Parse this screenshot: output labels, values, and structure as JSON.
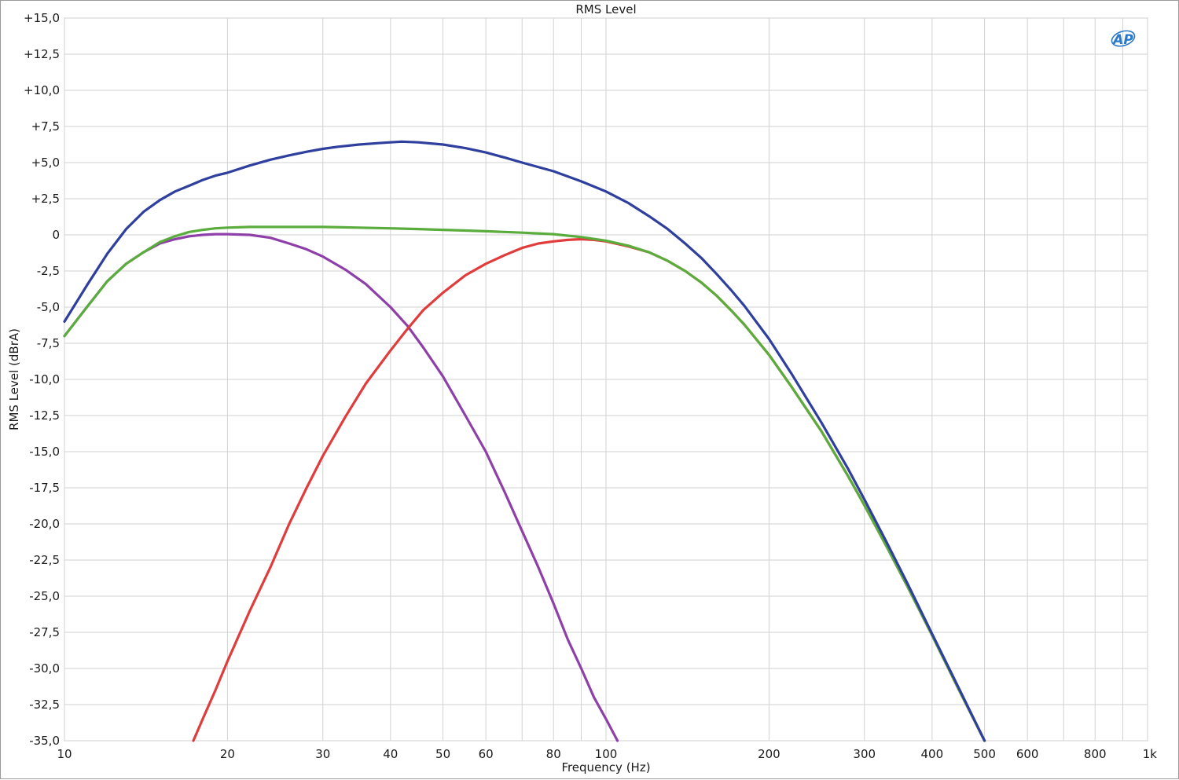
{
  "chart_data": {
    "type": "line",
    "title": "RMS Level",
    "xlabel": "Frequency (Hz)",
    "ylabel": "RMS Level (dBrA)",
    "xscale": "log",
    "xlim": [
      10,
      1000
    ],
    "ylim": [
      -35,
      15
    ],
    "grid": true,
    "legend": "none",
    "logo": "AP",
    "x_ticks": [
      {
        "value": 10,
        "label": "10"
      },
      {
        "value": 20,
        "label": "20"
      },
      {
        "value": 30,
        "label": "30"
      },
      {
        "value": 40,
        "label": "40"
      },
      {
        "value": 50,
        "label": "50"
      },
      {
        "value": 60,
        "label": "60"
      },
      {
        "value": 80,
        "label": "80"
      },
      {
        "value": 100,
        "label": "100"
      },
      {
        "value": 200,
        "label": "200"
      },
      {
        "value": 300,
        "label": "300"
      },
      {
        "value": 400,
        "label": "400"
      },
      {
        "value": 500,
        "label": "500"
      },
      {
        "value": 600,
        "label": "600"
      },
      {
        "value": 800,
        "label": "800"
      },
      {
        "value": 1000,
        "label": "1k"
      }
    ],
    "x_minor_grid": [
      70,
      90,
      700,
      900
    ],
    "y_ticks": [
      {
        "value": 15,
        "label": "+15,0"
      },
      {
        "value": 12.5,
        "label": "+12,5"
      },
      {
        "value": 10,
        "label": "+10,0"
      },
      {
        "value": 7.5,
        "label": "+7,5"
      },
      {
        "value": 5,
        "label": "+5,0"
      },
      {
        "value": 2.5,
        "label": "+2,5"
      },
      {
        "value": 0,
        "label": "0"
      },
      {
        "value": -2.5,
        "label": "-2,5"
      },
      {
        "value": -5,
        "label": "-5,0"
      },
      {
        "value": -7.5,
        "label": "-7,5"
      },
      {
        "value": -10,
        "label": "-10,0"
      },
      {
        "value": -12.5,
        "label": "-12,5"
      },
      {
        "value": -15,
        "label": "-15,0"
      },
      {
        "value": -17.5,
        "label": "-17,5"
      },
      {
        "value": -20,
        "label": "-20,0"
      },
      {
        "value": -22.5,
        "label": "-22,5"
      },
      {
        "value": -25,
        "label": "-25,0"
      },
      {
        "value": -27.5,
        "label": "-27,5"
      },
      {
        "value": -30,
        "label": "-30,0"
      },
      {
        "value": -32.5,
        "label": "-32,5"
      },
      {
        "value": -35,
        "label": "-35,0"
      }
    ],
    "series": [
      {
        "color": "#8e3fa8",
        "points": [
          [
            10,
            -7
          ],
          [
            11,
            -5
          ],
          [
            12,
            -3.2
          ],
          [
            13,
            -2
          ],
          [
            14,
            -1.2
          ],
          [
            15,
            -0.6
          ],
          [
            16,
            -0.3
          ],
          [
            17,
            -0.1
          ],
          [
            18,
            0
          ],
          [
            19,
            0.05
          ],
          [
            20,
            0.05
          ],
          [
            22,
            0
          ],
          [
            24,
            -0.2
          ],
          [
            26,
            -0.6
          ],
          [
            28,
            -1
          ],
          [
            30,
            -1.5
          ],
          [
            33,
            -2.4
          ],
          [
            36,
            -3.4
          ],
          [
            40,
            -5
          ],
          [
            43,
            -6.3
          ],
          [
            46,
            -7.8
          ],
          [
            50,
            -9.8
          ],
          [
            55,
            -12.5
          ],
          [
            60,
            -15
          ],
          [
            65,
            -17.8
          ],
          [
            70,
            -20.5
          ],
          [
            75,
            -23
          ],
          [
            80,
            -25.5
          ],
          [
            85,
            -28
          ],
          [
            90,
            -30
          ],
          [
            95,
            -32
          ],
          [
            100,
            -33.5
          ],
          [
            105,
            -35
          ]
        ]
      },
      {
        "color": "#e03c3c",
        "points": [
          [
            17.3,
            -35
          ],
          [
            18,
            -33.5
          ],
          [
            19,
            -31.5
          ],
          [
            20,
            -29.5
          ],
          [
            22,
            -26
          ],
          [
            24,
            -23
          ],
          [
            26,
            -20
          ],
          [
            28,
            -17.5
          ],
          [
            30,
            -15.3
          ],
          [
            33,
            -12.6
          ],
          [
            36,
            -10.3
          ],
          [
            40,
            -8
          ],
          [
            43,
            -6.5
          ],
          [
            46,
            -5.2
          ],
          [
            50,
            -4
          ],
          [
            55,
            -2.8
          ],
          [
            60,
            -2
          ],
          [
            65,
            -1.4
          ],
          [
            70,
            -0.9
          ],
          [
            75,
            -0.6
          ],
          [
            80,
            -0.45
          ],
          [
            85,
            -0.35
          ],
          [
            90,
            -0.3
          ],
          [
            95,
            -0.35
          ],
          [
            100,
            -0.45
          ],
          [
            110,
            -0.8
          ],
          [
            120,
            -1.2
          ],
          [
            130,
            -1.8
          ],
          [
            140,
            -2.5
          ],
          [
            150,
            -3.3
          ],
          [
            160,
            -4.2
          ],
          [
            170,
            -5.2
          ],
          [
            180,
            -6.2
          ],
          [
            200,
            -8.3
          ],
          [
            220,
            -10.5
          ],
          [
            250,
            -13.6
          ],
          [
            280,
            -16.7
          ],
          [
            300,
            -18.7
          ],
          [
            330,
            -21.6
          ],
          [
            360,
            -24.3
          ],
          [
            400,
            -27.7
          ],
          [
            450,
            -31.6
          ],
          [
            500,
            -35
          ]
        ]
      },
      {
        "color": "#5aad3c",
        "points": [
          [
            10,
            -7
          ],
          [
            11,
            -5
          ],
          [
            12,
            -3.2
          ],
          [
            13,
            -2
          ],
          [
            14,
            -1.2
          ],
          [
            15,
            -0.5
          ],
          [
            16,
            -0.1
          ],
          [
            17,
            0.2
          ],
          [
            18,
            0.35
          ],
          [
            19,
            0.45
          ],
          [
            20,
            0.5
          ],
          [
            22,
            0.55
          ],
          [
            25,
            0.55
          ],
          [
            30,
            0.55
          ],
          [
            35,
            0.5
          ],
          [
            40,
            0.45
          ],
          [
            45,
            0.4
          ],
          [
            50,
            0.35
          ],
          [
            55,
            0.3
          ],
          [
            60,
            0.25
          ],
          [
            70,
            0.15
          ],
          [
            80,
            0.05
          ],
          [
            90,
            -0.15
          ],
          [
            100,
            -0.4
          ],
          [
            110,
            -0.75
          ],
          [
            120,
            -1.2
          ],
          [
            130,
            -1.8
          ],
          [
            140,
            -2.5
          ],
          [
            150,
            -3.3
          ],
          [
            160,
            -4.2
          ],
          [
            170,
            -5.2
          ],
          [
            180,
            -6.2
          ],
          [
            200,
            -8.3
          ],
          [
            220,
            -10.5
          ],
          [
            250,
            -13.6
          ],
          [
            280,
            -16.7
          ],
          [
            300,
            -18.7
          ],
          [
            330,
            -21.6
          ],
          [
            360,
            -24.3
          ],
          [
            400,
            -27.7
          ],
          [
            450,
            -31.6
          ],
          [
            500,
            -35
          ]
        ]
      },
      {
        "color": "#2e3f9e",
        "points": [
          [
            10,
            -6
          ],
          [
            11,
            -3.5
          ],
          [
            12,
            -1.3
          ],
          [
            13,
            0.4
          ],
          [
            14,
            1.6
          ],
          [
            15,
            2.4
          ],
          [
            16,
            3
          ],
          [
            17,
            3.4
          ],
          [
            18,
            3.8
          ],
          [
            19,
            4.1
          ],
          [
            20,
            4.3
          ],
          [
            22,
            4.8
          ],
          [
            24,
            5.2
          ],
          [
            26,
            5.5
          ],
          [
            28,
            5.75
          ],
          [
            30,
            5.95
          ],
          [
            32,
            6.1
          ],
          [
            35,
            6.25
          ],
          [
            38,
            6.35
          ],
          [
            40,
            6.4
          ],
          [
            42,
            6.45
          ],
          [
            45,
            6.4
          ],
          [
            50,
            6.25
          ],
          [
            55,
            6.0
          ],
          [
            60,
            5.7
          ],
          [
            65,
            5.35
          ],
          [
            70,
            5.0
          ],
          [
            80,
            4.4
          ],
          [
            90,
            3.7
          ],
          [
            100,
            3.0
          ],
          [
            110,
            2.2
          ],
          [
            120,
            1.3
          ],
          [
            130,
            0.4
          ],
          [
            140,
            -0.6
          ],
          [
            150,
            -1.6
          ],
          [
            160,
            -2.7
          ],
          [
            170,
            -3.8
          ],
          [
            180,
            -4.9
          ],
          [
            200,
            -7.2
          ],
          [
            220,
            -9.6
          ],
          [
            250,
            -13.0
          ],
          [
            280,
            -16.2
          ],
          [
            300,
            -18.3
          ],
          [
            330,
            -21.3
          ],
          [
            360,
            -24.1
          ],
          [
            400,
            -27.6
          ],
          [
            450,
            -31.5
          ],
          [
            500,
            -35
          ]
        ]
      }
    ]
  }
}
